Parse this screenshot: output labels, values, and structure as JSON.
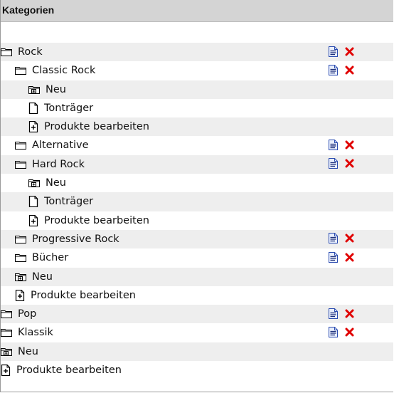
{
  "panel": {
    "title": "Kategorien"
  },
  "colors": {
    "header_bg": "#d4d4d4",
    "row_shade": "#eeeeee",
    "edit_icon": "#2a4bb0",
    "delete_icon": "#e00000"
  },
  "tree": {
    "rows": [
      {
        "label": "Rock",
        "icon": "folder-icon",
        "level": 0,
        "shaded": true,
        "actions": true
      },
      {
        "label": "Classic Rock",
        "icon": "folder-icon",
        "level": 1,
        "shaded": false,
        "actions": true
      },
      {
        "label": "Neu",
        "icon": "folder-add-icon",
        "level": 2,
        "shaded": true,
        "actions": false
      },
      {
        "label": "Tonträger",
        "icon": "document-icon",
        "level": 2,
        "shaded": false,
        "actions": false
      },
      {
        "label": "Produkte bearbeiten",
        "icon": "edit-products-icon",
        "level": 2,
        "shaded": true,
        "actions": false
      },
      {
        "label": "Alternative",
        "icon": "folder-icon",
        "level": 1,
        "shaded": false,
        "actions": true
      },
      {
        "label": "Hard Rock",
        "icon": "folder-icon",
        "level": 1,
        "shaded": true,
        "actions": true
      },
      {
        "label": "Neu",
        "icon": "folder-add-icon",
        "level": 2,
        "shaded": false,
        "actions": false
      },
      {
        "label": "Tonträger",
        "icon": "document-icon",
        "level": 2,
        "shaded": true,
        "actions": false
      },
      {
        "label": "Produkte bearbeiten",
        "icon": "edit-products-icon",
        "level": 2,
        "shaded": false,
        "actions": false
      },
      {
        "label": "Progressive Rock",
        "icon": "folder-icon",
        "level": 1,
        "shaded": true,
        "actions": true
      },
      {
        "label": "Bücher",
        "icon": "folder-icon",
        "level": 1,
        "shaded": false,
        "actions": true
      },
      {
        "label": "Neu",
        "icon": "folder-add-icon",
        "level": 1,
        "shaded": true,
        "actions": false
      },
      {
        "label": "Produkte bearbeiten",
        "icon": "edit-products-icon",
        "level": 1,
        "shaded": false,
        "actions": false
      },
      {
        "label": "Pop",
        "icon": "folder-icon",
        "level": 0,
        "shaded": true,
        "actions": true
      },
      {
        "label": "Klassik",
        "icon": "folder-icon",
        "level": 0,
        "shaded": false,
        "actions": true
      },
      {
        "label": "Neu",
        "icon": "folder-add-icon",
        "level": 0,
        "shaded": true,
        "actions": false
      },
      {
        "label": "Produkte bearbeiten",
        "icon": "edit-products-icon",
        "level": 0,
        "shaded": false,
        "actions": false
      }
    ]
  }
}
